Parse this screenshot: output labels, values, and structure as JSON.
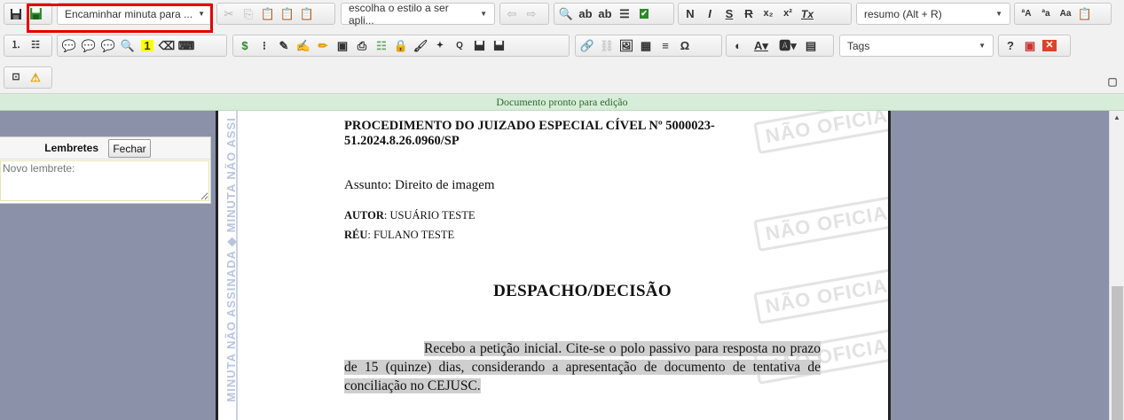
{
  "toolbar": {
    "combo_forward": "Encaminhar minuta para ...",
    "combo_style": "escolha o estilo a ser apli...",
    "combo_summary": "resumo (Alt + R)",
    "combo_tags": "Tags",
    "bold": "N",
    "italic": "I",
    "underline": "S",
    "strike": "R",
    "subscript": "x₂",
    "superscript": "x²",
    "clear_format": "Tx",
    "font_a1": "ªA",
    "font_a2": "ªa",
    "font_aa": "Aa",
    "omega": "Ω",
    "help": "?",
    "number_one": "1",
    "dollar": "$"
  },
  "status": "Documento pronto para edição",
  "reminders": {
    "title": "Lembretes",
    "close_label": "Fechar",
    "placeholder": "Novo lembrete:"
  },
  "document": {
    "margin_text": "MINUTA NÃO ASSINADA ◆ MINUTA NÃO ASSI",
    "watermark": "NÃO OFICIAL",
    "procedure": "PROCEDIMENTO DO JUIZADO ESPECIAL CÍVEL Nº 5000023-51.2024.8.26.0960/SP",
    "subject": "Assunto: Direito de imagem",
    "author_label": "AUTOR",
    "author_value": ": USUÁRIO TESTE",
    "defendant_label": "RÉU",
    "defendant_value": ": FULANO TESTE",
    "title": "DESPACHO/DECISÃO",
    "body": "Recebo a petição inicial. Cite-se o polo passivo para resposta no prazo de 15 (quinze) dias, considerando a apresentação de documento de tentativa de conciliação no CEJUSC."
  },
  "colors": {
    "highlight_border": "#e00000",
    "status_bg": "#d7ecd9",
    "workspace_bg": "#8a91a8"
  }
}
